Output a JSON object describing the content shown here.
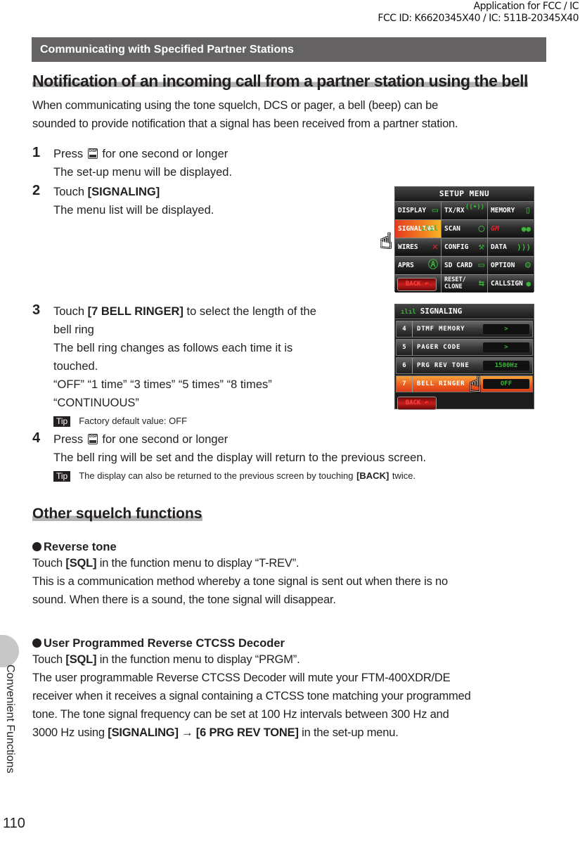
{
  "header": {
    "fcc_line1": "Application for FCC / IC",
    "fcc_line2": "FCC ID: K6620345X40 / IC: 511B-20345X40"
  },
  "section_bar": "Communicating with Specified Partner Stations",
  "heading1": "Notification of an incoming call from a partner station using the bell",
  "intro": {
    "line1": "When communicating using the tone squelch, DCS or pager, a bell (beep) can be",
    "line2": "sounded to provide notification that a signal has been received from a partner station."
  },
  "steps": [
    {
      "num": "1",
      "pre": "Press",
      "key_top": "DISP",
      "post": "for one second or longer",
      "result": "The set-up menu will be displayed."
    },
    {
      "num": "2",
      "pre": "Touch",
      "bold": "[SIGNALING]",
      "result": "The menu list will be displayed."
    },
    {
      "num": "3",
      "pre": "Touch",
      "bold": "[7 BELL RINGER]",
      "post": "to select the length of the",
      "post2": "bell ring",
      "result1": "The bell ring changes as follows each time it is",
      "result2": "touched.",
      "options1": "“OFF” “1 time” “3 times” “5 times” “8 times”",
      "options2": "“CONTINUOUS”",
      "tip_label": "Tip",
      "tip": "Factory default value: OFF"
    },
    {
      "num": "4",
      "pre": "Press",
      "key_top": "DISP",
      "post": "for one second or longer",
      "result": "The bell ring will be set and the display will return to the previous screen.",
      "tip_label": "Tip",
      "tip_pre": "The display can also be returned to the previous screen by touching",
      "tip_bold": "[BACK]",
      "tip_post": "twice."
    }
  ],
  "setup_screen": {
    "title": "SETUP MENU",
    "cells": [
      {
        "label": "DISPLAY",
        "icon": "▭"
      },
      {
        "label": "TX/RX",
        "icon": "((•))"
      },
      {
        "label": "MEMORY",
        "icon": "▯▯"
      },
      {
        "label": "SIGNALING",
        "icon": "ılıl"
      },
      {
        "label": "SCAN",
        "icon": "◯"
      },
      {
        "label": "GM",
        "icon": "👥"
      },
      {
        "label": "WIRES",
        "icon": "✕"
      },
      {
        "label": "CONFIG",
        "icon": "🔧"
      },
      {
        "label": "DATA",
        "icon": ")))"
      },
      {
        "label": "APRS",
        "icon": "Ⓐ"
      },
      {
        "label": "SD CARD",
        "icon": "▭"
      },
      {
        "label": "OPTION",
        "icon": "⚙"
      },
      {
        "label": "BACK",
        "icon": "↶"
      },
      {
        "label_line1": "RESET/",
        "label_line2": "CLONE",
        "icon": "⇆"
      },
      {
        "label": "CALLSIGN",
        "icon": "👤"
      }
    ]
  },
  "signaling_screen": {
    "title": "SIGNALING",
    "rows": [
      {
        "num": "4",
        "label": "DTMF MEMORY",
        "value": ">"
      },
      {
        "num": "5",
        "label": "PAGER CODE",
        "value": ">"
      },
      {
        "num": "6",
        "label": "PRG REV TONE",
        "value": "1500Hz"
      },
      {
        "num": "7",
        "label": "BELL RINGER",
        "value": "OFF"
      }
    ],
    "back": "BACK"
  },
  "heading2": "Other squelch functions",
  "reverse_tone": {
    "title": "Reverse tone",
    "l1_pre": "Touch",
    "l1_bold": "[SQL]",
    "l1_post": "in the function menu to display “T-REV”.",
    "l2": "This is a communication method whereby a tone signal is sent out when there is no",
    "l3": "sound. When there is a sound, the tone signal will disappear."
  },
  "rev_ctcss": {
    "title": "User Programmed Reverse CTCSS Decoder",
    "l1_pre": "Touch",
    "l1_bold": "[SQL]",
    "l1_post": "in the function menu to display “PRGM”.",
    "l2": "The user programmable Reverse CTCSS Decoder will mute your FTM-400XDR/DE",
    "l3": "receiver when it receives a signal containing a CTCSS tone matching your programmed",
    "l4": "tone. The tone signal frequency can be set at 100 Hz intervals between 300 Hz and",
    "l5_pre": "3000 Hz using",
    "l5_bold": "[SIGNALING] → [6 PRG REV TONE]",
    "l5_post": "in the set-up menu."
  },
  "side_label": "Convenient Functions",
  "page_number": "110"
}
